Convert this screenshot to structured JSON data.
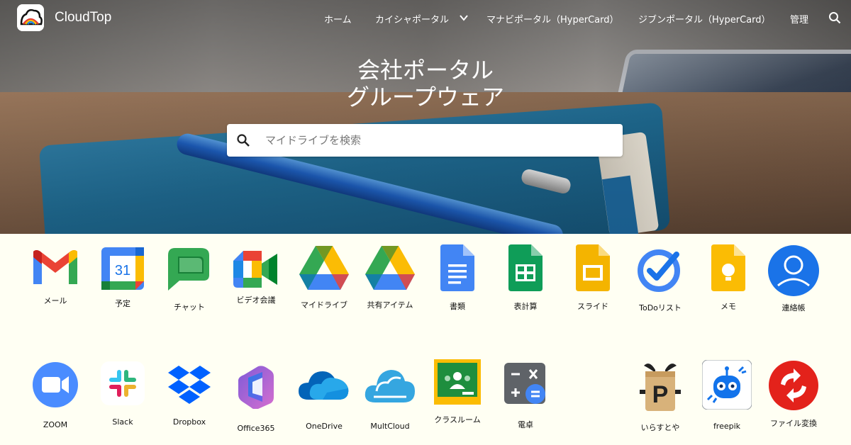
{
  "nav": {
    "brand": "CloudTop",
    "links": [
      "ホーム",
      "カイシャポータル",
      "マナビポータル（HyperCard）",
      "ジブンポータル（HyperCard）",
      "管理"
    ]
  },
  "hero": {
    "title_line1": "会社ポータル",
    "title_line2": "グループウェア",
    "search_placeholder": "マイドライブを検索"
  },
  "apps_row1": [
    {
      "label": "メール",
      "icon": "gmail-icon"
    },
    {
      "label": "予定",
      "icon": "calendar-icon"
    },
    {
      "label": "チャット",
      "icon": "chat-icon"
    },
    {
      "label": "ビデオ会議",
      "icon": "meet-icon"
    },
    {
      "label": "マイドライブ",
      "icon": "drive-icon"
    },
    {
      "label": "共有アイテム",
      "icon": "drive-icon"
    },
    {
      "label": "書類",
      "icon": "docs-icon"
    },
    {
      "label": "表計算",
      "icon": "sheets-icon"
    },
    {
      "label": "スライド",
      "icon": "slides-icon"
    },
    {
      "label": "ToDoリスト",
      "icon": "todo-icon"
    },
    {
      "label": "メモ",
      "icon": "keep-icon"
    },
    {
      "label": "連絡帳",
      "icon": "contacts-icon"
    }
  ],
  "apps_row2": [
    {
      "label": "ZOOM",
      "icon": "zoom-icon"
    },
    {
      "label": "Slack",
      "icon": "slack-icon"
    },
    {
      "label": "Dropbox",
      "icon": "dropbox-icon"
    },
    {
      "label": "Office365",
      "icon": "office365-icon"
    },
    {
      "label": "OneDrive",
      "icon": "onedrive-icon"
    },
    {
      "label": "MultCloud",
      "icon": "multcloud-icon"
    },
    {
      "label": "クラスルーム",
      "icon": "classroom-icon"
    },
    {
      "label": "電卓",
      "icon": "calculator-icon"
    },
    {
      "label": "いらすとや",
      "icon": "irasutoya-icon"
    },
    {
      "label": "freepik",
      "icon": "freepik-icon"
    },
    {
      "label": "ファイル変換",
      "icon": "file-convert-icon"
    }
  ],
  "colors": {
    "page_bg": "#fffff3",
    "google_blue": "#4285f4",
    "google_red": "#ea4335",
    "google_yellow": "#fbbc04",
    "google_green": "#34a853"
  }
}
